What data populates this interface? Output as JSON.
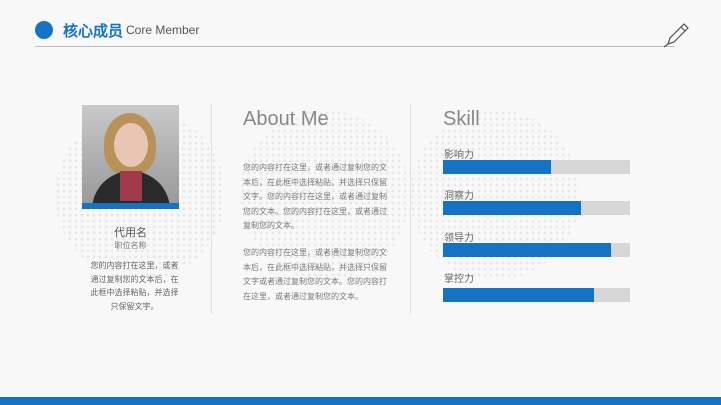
{
  "header": {
    "title": "核心成员",
    "subtitle": "Core Member"
  },
  "profile": {
    "name": "代用名",
    "position": "职位名称",
    "description": "您的内容打在这里，或者通过复制您的文本后，在此框中选择粘贴，并选择只保留文字。"
  },
  "about": {
    "heading": "About Me",
    "paragraph1": "您的内容打在这里，或者通过复制您的文本后，在此框中选择粘贴，并选择只保留文字。您的内容打在这里，或者通过复制您的文本。您的内容打在这里，或者通过复制您的文本。",
    "paragraph2": "您的内容打在这里，或者通过复制您的文本后，在此框中选择粘贴，并选择只保留文字或者通过复制您的文本。您的内容打在这里，或者通过复制您的文本。"
  },
  "skills": {
    "heading": "Skill",
    "items": [
      {
        "label": "影响力",
        "value": 0.58
      },
      {
        "label": "洞察力",
        "value": 0.74
      },
      {
        "label": "领导力",
        "value": 0.9
      },
      {
        "label": "掌控力",
        "value": 0.81
      }
    ]
  },
  "colors": {
    "accent": "#1573c6",
    "track": "#d7d7d7"
  },
  "icons": {
    "header": "pen-icon"
  }
}
